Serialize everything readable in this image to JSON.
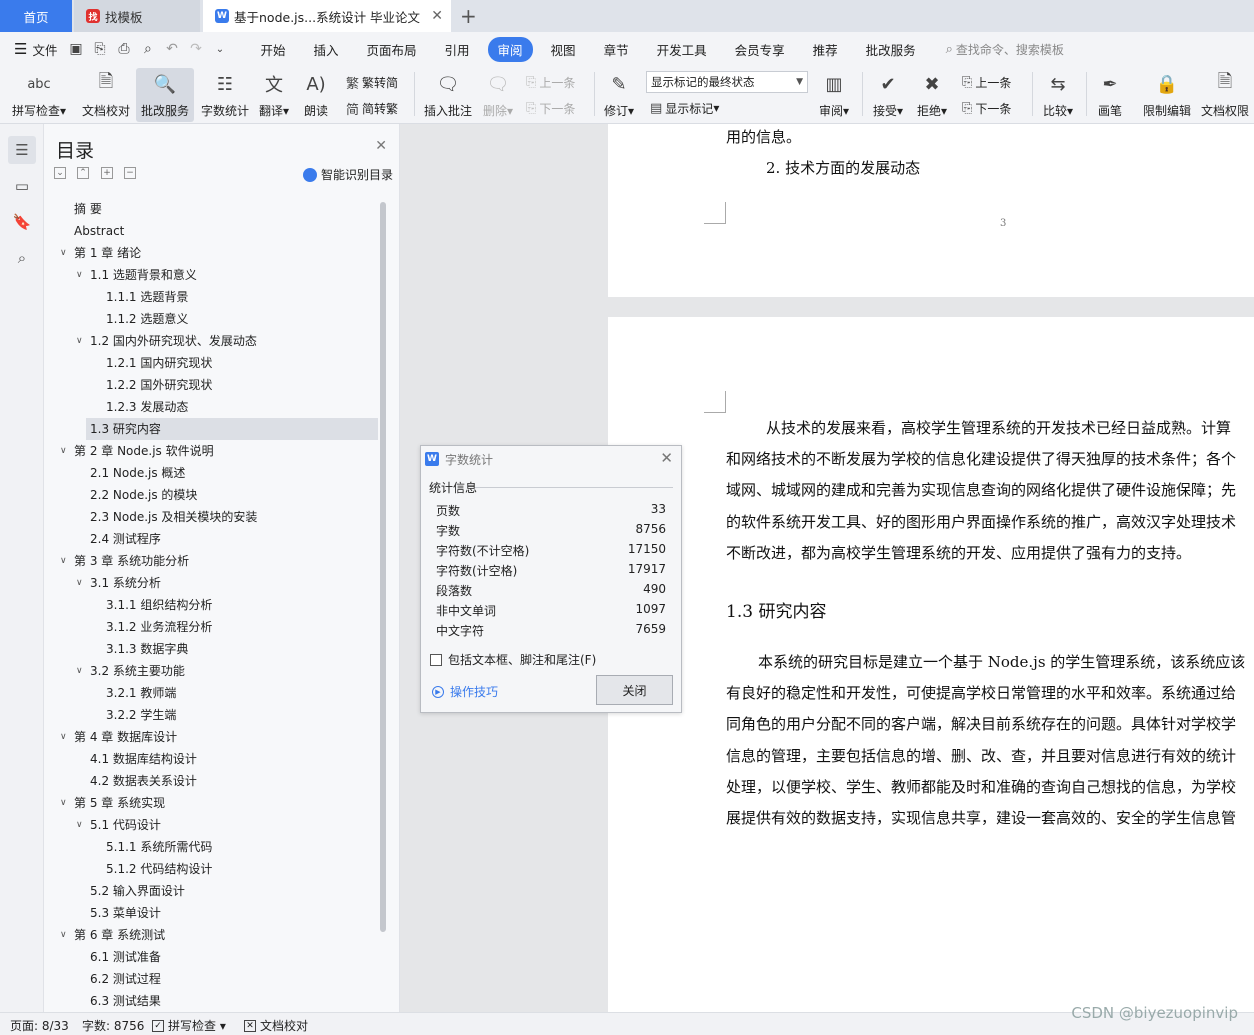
{
  "tabs": {
    "home": "首页",
    "template": "找模板",
    "document": "基于node.js...系统设计 毕业论文",
    "close_icon": "close-icon",
    "add_icon": "plus-icon"
  },
  "menu": {
    "file": "文件",
    "items": [
      "开始",
      "插入",
      "页面布局",
      "引用",
      "审阅",
      "视图",
      "章节",
      "开发工具",
      "会员专享",
      "推荐",
      "批改服务"
    ],
    "active": "审阅",
    "search_placeholder": "查找命令、搜索模板"
  },
  "ribbon": {
    "spell_check": "拼写检查",
    "doc_proof": "文档校对",
    "review_service": "批改服务",
    "word_count": "字数统计",
    "translate": "翻译",
    "read_aloud": "朗读",
    "trad_to_simp": "繁转简",
    "simp_to_trad": "简转繁",
    "insert_comment": "插入批注",
    "delete": "删除",
    "prev_comment": "上一条",
    "next_comment": "下一条",
    "track_changes": "修订",
    "markup_state": "显示标记的最终状态",
    "show_markup": "显示标记",
    "review": "审阅",
    "accept": "接受",
    "reject": "拒绝",
    "prev_change": "上一条",
    "next_change": "下一条",
    "compare": "比较",
    "pen": "画笔",
    "restrict_edit": "限制编辑",
    "doc_permission": "文档权限"
  },
  "toc": {
    "title": "目录",
    "smart": "智能识别目录",
    "items": [
      {
        "level": 0,
        "text": "摘   要",
        "chev": ""
      },
      {
        "level": 0,
        "text": "Abstract",
        "chev": ""
      },
      {
        "level": 0,
        "text": "第 1 章  绪论",
        "chev": "v"
      },
      {
        "level": 1,
        "text": "1.1 选题背景和意义",
        "chev": "v"
      },
      {
        "level": 2,
        "text": "1.1.1 选题背景",
        "chev": ""
      },
      {
        "level": 2,
        "text": "1.1.2 选题意义",
        "chev": ""
      },
      {
        "level": 1,
        "text": "1.2 国内外研究现状、发展动态",
        "chev": "v"
      },
      {
        "level": 2,
        "text": "1.2.1 国内研究现状",
        "chev": ""
      },
      {
        "level": 2,
        "text": "1.2.2 国外研究现状",
        "chev": ""
      },
      {
        "level": 2,
        "text": "1.2.3 发展动态",
        "chev": ""
      },
      {
        "level": 1,
        "text": "1.3 研究内容",
        "chev": "",
        "active": true
      },
      {
        "level": 0,
        "text": "第 2 章  Node.js 软件说明",
        "chev": "v"
      },
      {
        "level": 1,
        "text": "2.1 Node.js 概述",
        "chev": ""
      },
      {
        "level": 1,
        "text": "2.2 Node.js 的模块",
        "chev": ""
      },
      {
        "level": 1,
        "text": "2.3 Node.js 及相关模块的安装",
        "chev": ""
      },
      {
        "level": 1,
        "text": "2.4  测试程序",
        "chev": ""
      },
      {
        "level": 0,
        "text": "第 3 章   系统功能分析",
        "chev": "v"
      },
      {
        "level": 1,
        "text": "3.1 系统分析",
        "chev": "v"
      },
      {
        "level": 2,
        "text": "3.1.1 组织结构分析",
        "chev": ""
      },
      {
        "level": 2,
        "text": "3.1.2 业务流程分析",
        "chev": ""
      },
      {
        "level": 2,
        "text": "3.1.3 数据字典",
        "chev": ""
      },
      {
        "level": 1,
        "text": "3.2 系统主要功能",
        "chev": "v"
      },
      {
        "level": 2,
        "text": "3.2.1  教师端",
        "chev": ""
      },
      {
        "level": 2,
        "text": "3.2.2  学生端",
        "chev": ""
      },
      {
        "level": 0,
        "text": "第 4 章   数据库设计",
        "chev": "v"
      },
      {
        "level": 1,
        "text": "4.1 数据库结构设计",
        "chev": ""
      },
      {
        "level": 1,
        "text": "4.2 数据表关系设计",
        "chev": ""
      },
      {
        "level": 0,
        "text": "第 5 章   系统实现",
        "chev": "v"
      },
      {
        "level": 1,
        "text": "5.1 代码设计",
        "chev": "v"
      },
      {
        "level": 2,
        "text": "5.1.1 系统所需代码",
        "chev": ""
      },
      {
        "level": 2,
        "text": "5.1.2 代码结构设计",
        "chev": ""
      },
      {
        "level": 1,
        "text": "5.2 输入界面设计",
        "chev": ""
      },
      {
        "level": 1,
        "text": "5.3 菜单设计",
        "chev": ""
      },
      {
        "level": 0,
        "text": "第 6 章   系统测试",
        "chev": "v"
      },
      {
        "level": 1,
        "text": "6.1 测试准备",
        "chev": ""
      },
      {
        "level": 1,
        "text": "6.2 测试过程",
        "chev": ""
      },
      {
        "level": 1,
        "text": "6.3 测试结果",
        "chev": ""
      }
    ]
  },
  "document": {
    "page1_top": "用的信息。",
    "page1_item": "2.  技术方面的发展动态",
    "page_number": "3",
    "para1": [
      "从技术的发展来看，高校学生管理系统的开发技术已经日益成熟。计算",
      "和网络技术的不断发展为学校的信息化建设提供了得天独厚的技术条件；各个",
      "域网、城域网的建成和完善为实现信息查询的网络化提供了硬件设施保障；先",
      "的软件系统开发工具、好的图形用户界面操作系统的推广，高效汉字处理技术",
      "不断改进，都为高校学生管理系统的开发、应用提供了强有力的支持。"
    ],
    "heading": "1.3 研究内容",
    "para2": [
      "本系统的研究目标是建立一个基于 Node.js 的学生管理系统，该系统应该",
      "有良好的稳定性和开发性，可使提高学校日常管理的水平和效率。系统通过给",
      "同角色的用户分配不同的客户端，解决目前系统存在的问题。具体针对学校学",
      "信息的管理，主要包括信息的增、删、改、查，并且要对信息进行有效的统计",
      "处理，以便学校、学生、教师都能及时和准确的查询自己想找的信息，为学校",
      "展提供有效的数据支持，实现信息共享，建设一套高效的、安全的学生信息管"
    ]
  },
  "word_count_dialog": {
    "title": "字数统计",
    "group": "统计信息",
    "rows": [
      {
        "label": "页数",
        "value": "33"
      },
      {
        "label": "字数",
        "value": "8756"
      },
      {
        "label": "字符数(不计空格)",
        "value": "17150"
      },
      {
        "label": "字符数(计空格)",
        "value": "17917"
      },
      {
        "label": "段落数",
        "value": "490"
      },
      {
        "label": "非中文单词",
        "value": "1097"
      },
      {
        "label": "中文字符",
        "value": "7659"
      }
    ],
    "include_checkbox": "包括文本框、脚注和尾注(F)",
    "include_checked": false,
    "tips": "操作技巧",
    "close_button": "关闭"
  },
  "status": {
    "page": "页面: 8/33",
    "words": "字数: 8756",
    "spell": "拼写检查",
    "proof": "文档校对",
    "watermark": "CSDN @biyezuopinvip"
  },
  "colors": {
    "accent": "#3a7bec",
    "template_icon": "#e0312f"
  }
}
